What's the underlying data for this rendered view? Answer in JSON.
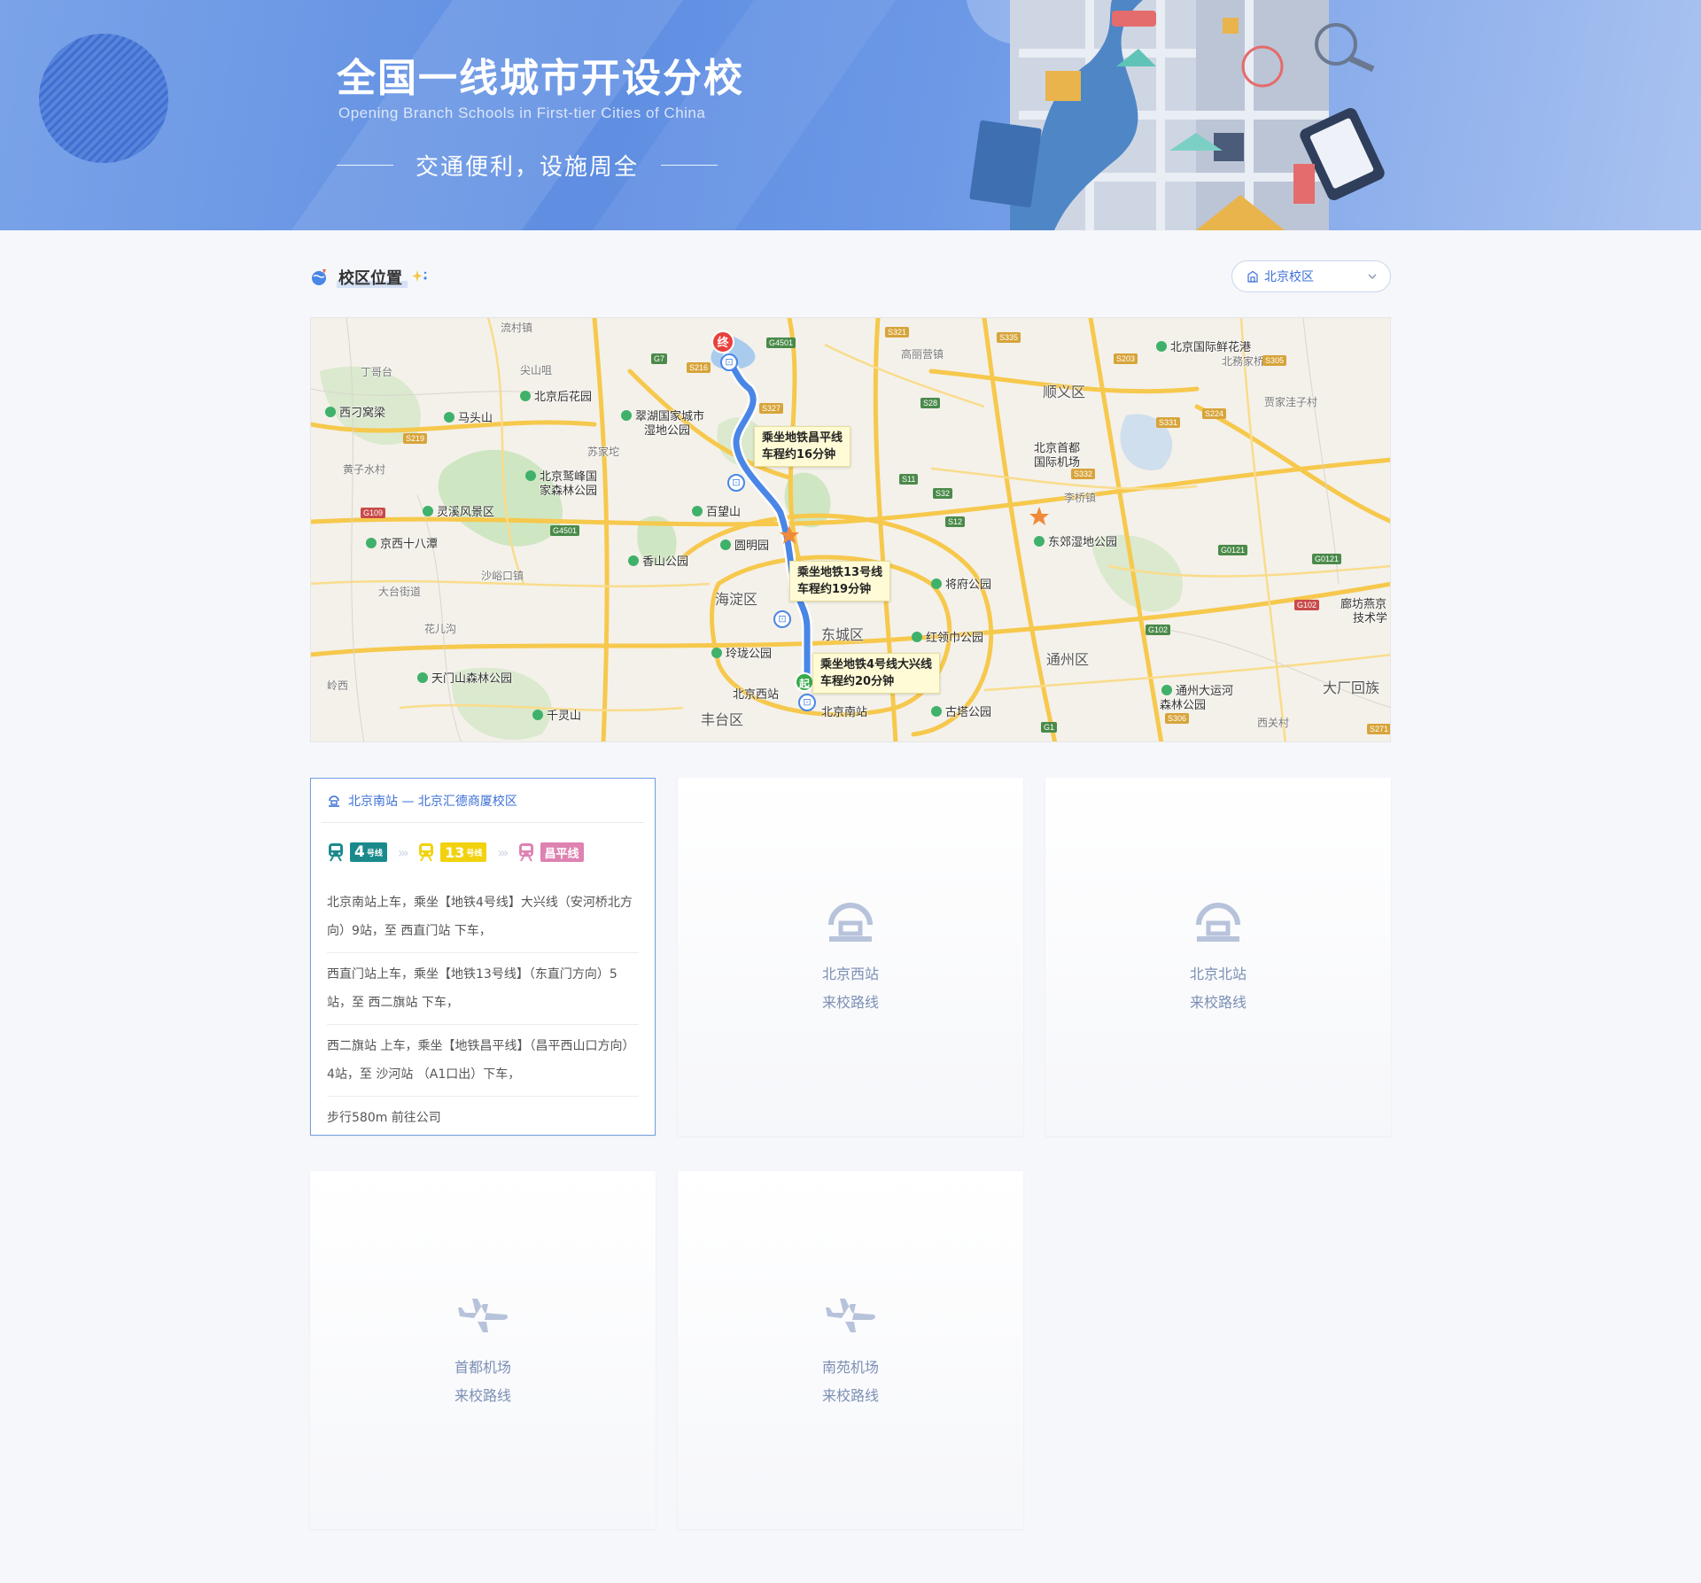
{
  "banner": {
    "title": "全国一线城市开设分校",
    "subtitle": "Opening Branch Schools in First-tier Cities of China",
    "slogan": "交通便利，设施周全"
  },
  "section": {
    "title": "校区位置",
    "campus_select": "北京校区"
  },
  "map": {
    "tips": [
      {
        "line1": "乘坐地铁昌平线",
        "line2": "车程约16分钟"
      },
      {
        "line1": "乘坐地铁13号线",
        "line2": "车程约19分钟"
      },
      {
        "line1": "乘坐地铁4号线大兴线",
        "line2": "车程约20分钟"
      }
    ],
    "end_marker": "终",
    "start_marker": "起",
    "places": {
      "shunyi": "顺义区",
      "haidian": "海淀区",
      "dongcheng": "东城区",
      "tongzhou": "通州区",
      "fengtai": "丰台区",
      "dachang": "大厂回族",
      "airport": "北京首都",
      "airport2": "国际机场",
      "huaxiang": "北京国际鲜花港",
      "xidiao": "西刁窝梁",
      "matou": "马头山",
      "houhua": "北京后花园",
      "cuihu": "翠湖国家城市",
      "cuihu2": "湿地公园",
      "jiufeng": "北京鹫峰国",
      "jiufeng2": "家森林公园",
      "lingxi": "灵溪风景区",
      "jingxi": "京西十八潭",
      "baiwang": "百望山",
      "yuanming": "圆明园",
      "xiangshan": "香山公园",
      "jiangfu": "将府公园",
      "hongling": "红领巾公园",
      "linglong": "玲珑公园",
      "bjxz": "北京西站",
      "bjnz": "北京南站",
      "gutap": "古塔公园",
      "tianmen": "天门山森林公园",
      "qianling": "千灵山",
      "dongjiao": "东郊湿地公园",
      "tongzhou_park": "通州大运河",
      "tongzhou_park2": "森林公园",
      "langfang": "廊坊燕京",
      "langfang2": "技术学",
      "gaoliying": "高丽营镇",
      "beiliu": "北務家桥",
      "jiajia": "贾家洼子村",
      "suijia": "苏家坨",
      "liyuan": "李桥镇",
      "dataijie": "大台街道",
      "huaercun": "花儿沟",
      "quanzi": "黄子水村",
      "dinggezhuang": "丁哥台",
      "baishan": "尖山咀",
      "liucun": "流村镇",
      "shahe": "沙峪口镇",
      "lingxi2": "岭西",
      "xiguan": "西关村"
    },
    "highways": [
      "G7",
      "S216",
      "G4501",
      "S321",
      "S335",
      "S203",
      "S305",
      "S327",
      "S28",
      "S219",
      "S224",
      "S331",
      "S11",
      "S32",
      "S332",
      "G109",
      "G4501",
      "S12",
      "G0121",
      "G0121",
      "G102",
      "G102",
      "G1",
      "S306",
      "S271"
    ]
  },
  "cards": {
    "active": {
      "title": "北京南站 — 北京汇德商厦校区",
      "lines": [
        {
          "num": "4",
          "text": "号线",
          "color": "#1b8a8c"
        },
        {
          "num": "13",
          "text": "号线",
          "color": "#f2d20e"
        },
        {
          "num": "",
          "text": "昌平线",
          "color": "#de82b2"
        }
      ],
      "chevrons": "›››",
      "steps": [
        "北京南站上车，乘坐【地铁4号线】大兴线（安河桥北方向）9站，至 西直门站 下车，",
        "西直门站上车，乘坐【地铁13号线】（东直门方向）5站，至 西二旗站 下车，",
        "西二旗站  上车，乘坐【地铁昌平线】（昌平西山口方向）4站，至 沙河站 （A1口出）下车，",
        "步行580m 前往公司"
      ]
    },
    "others": [
      {
        "name": "北京西站",
        "sub": "来校路线",
        "icon": "train-station-icon"
      },
      {
        "name": "北京北站",
        "sub": "来校路线",
        "icon": "train-station-icon"
      },
      {
        "name": "首都机场",
        "sub": "来校路线",
        "icon": "airplane-icon"
      },
      {
        "name": "南苑机场",
        "sub": "来校路线",
        "icon": "airplane-icon"
      }
    ]
  },
  "colors": {
    "accent": "#3b6fd4",
    "route": "#4a86e6",
    "line4": "#1b8a8c",
    "line13": "#f2d20e",
    "changping": "#de82b2"
  }
}
